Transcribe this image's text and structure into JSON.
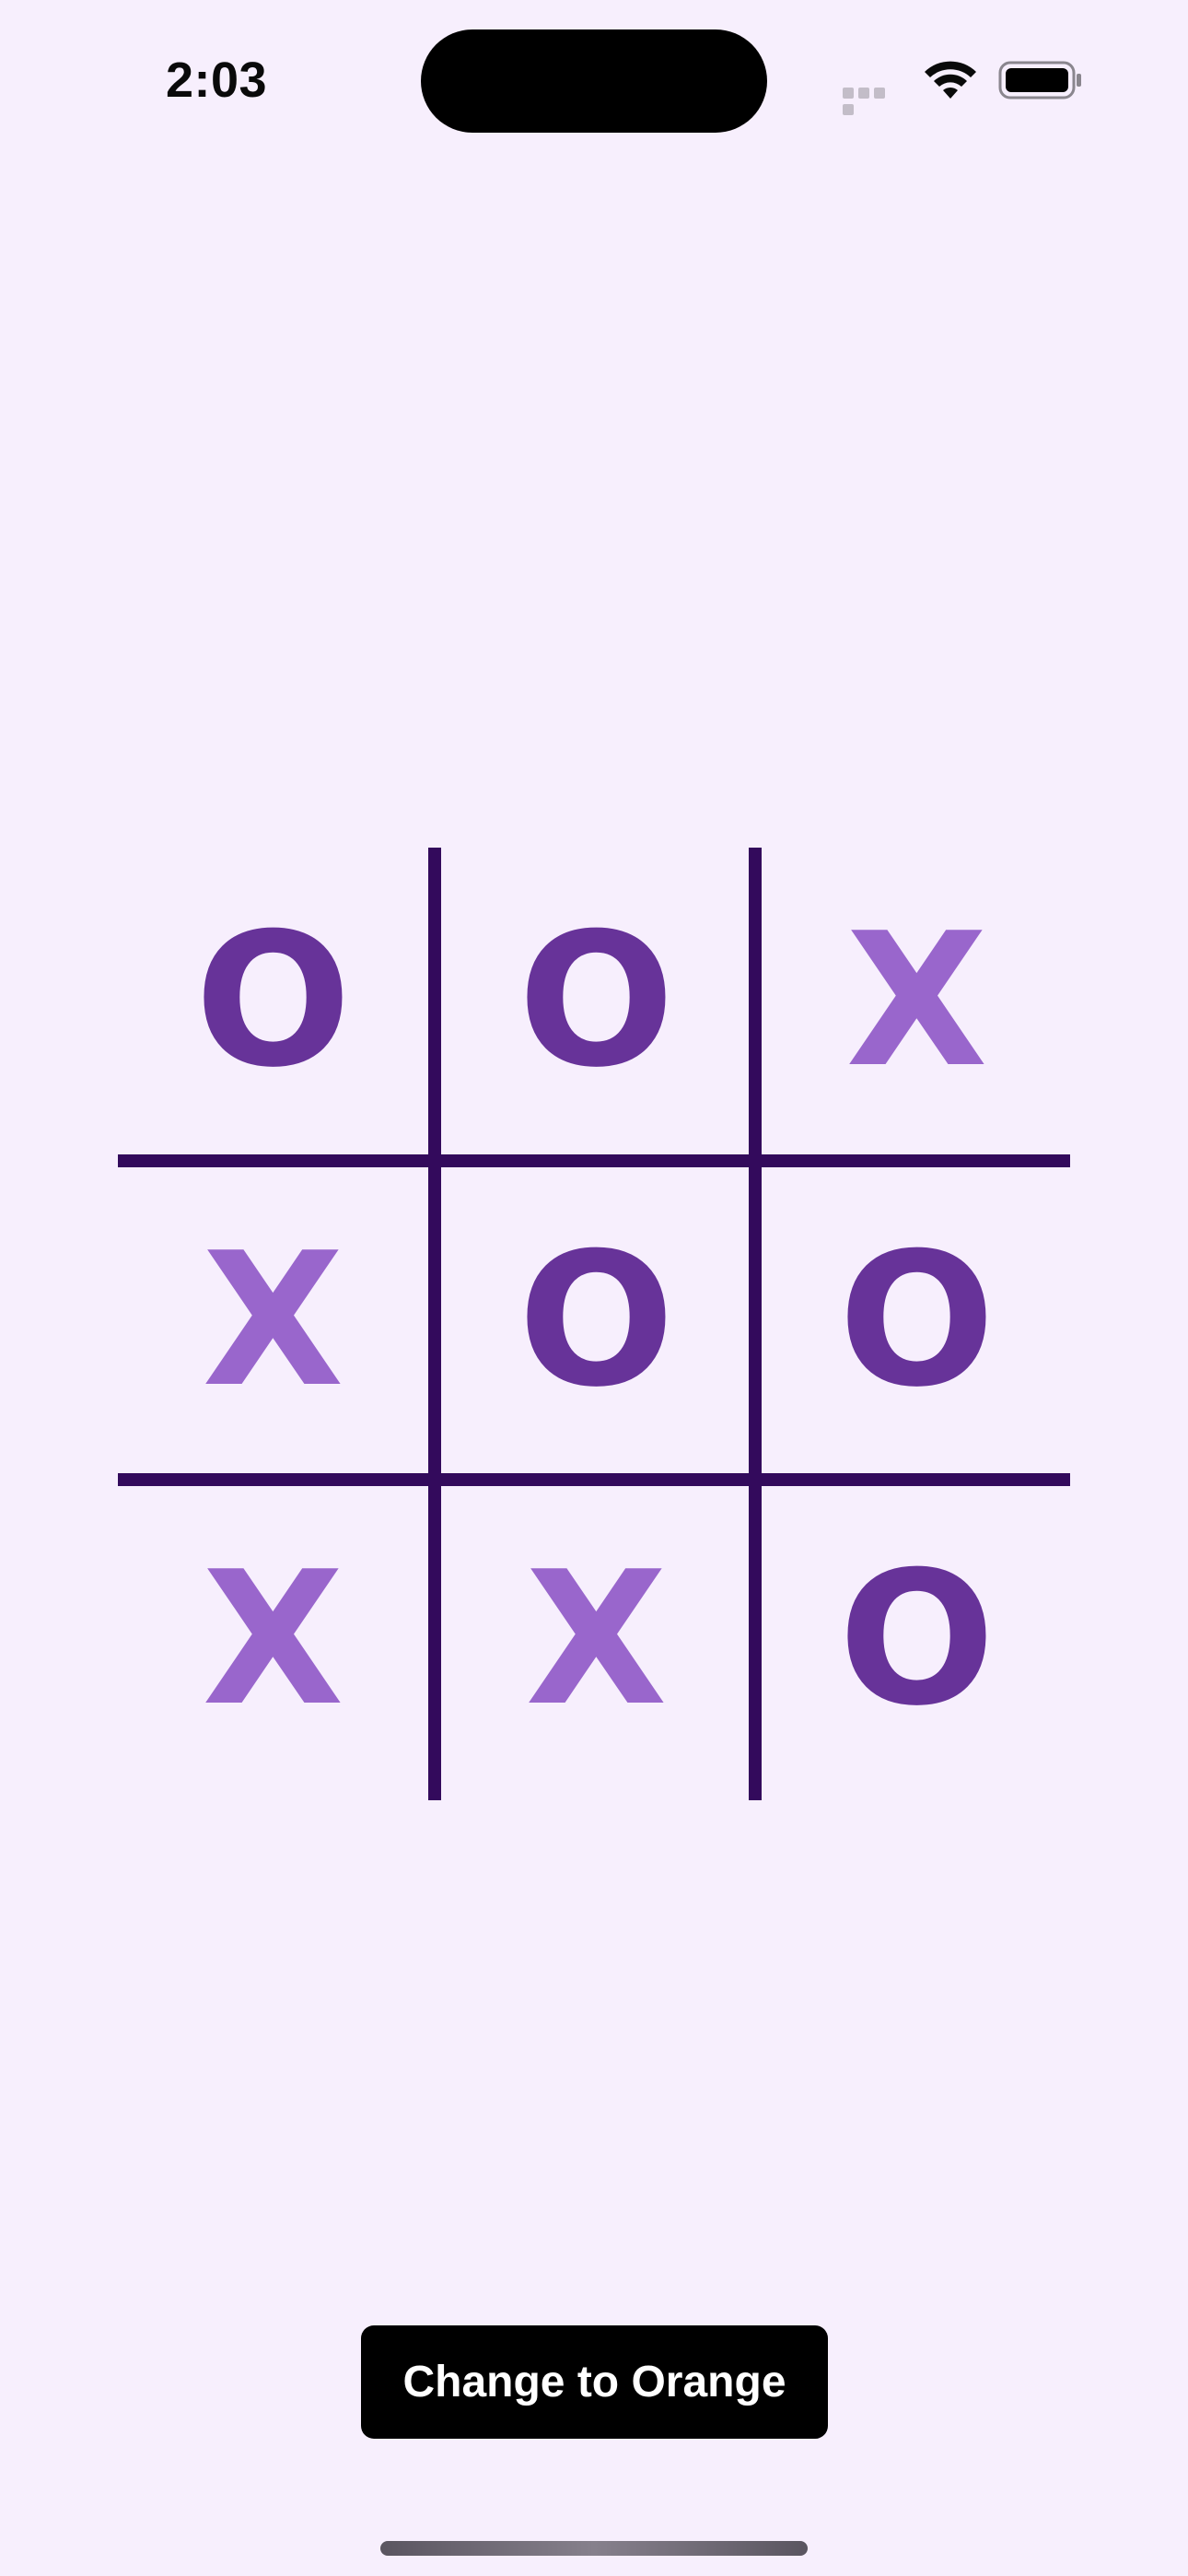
{
  "status_bar": {
    "time": "2:03",
    "icons": [
      "cellular-signal-icon",
      "wifi-icon",
      "battery-icon"
    ]
  },
  "board": {
    "cells": [
      [
        "O",
        "O",
        "X"
      ],
      [
        "X",
        "O",
        "O"
      ],
      [
        "X",
        "X",
        "O"
      ]
    ]
  },
  "colors": {
    "background": "#f7effd",
    "grid": "#330a5c",
    "mark_o": "#673399",
    "mark_x": "#9966cc",
    "button_bg": "#000000",
    "button_text": "#ffffff"
  },
  "button": {
    "label": "Change to Orange"
  }
}
